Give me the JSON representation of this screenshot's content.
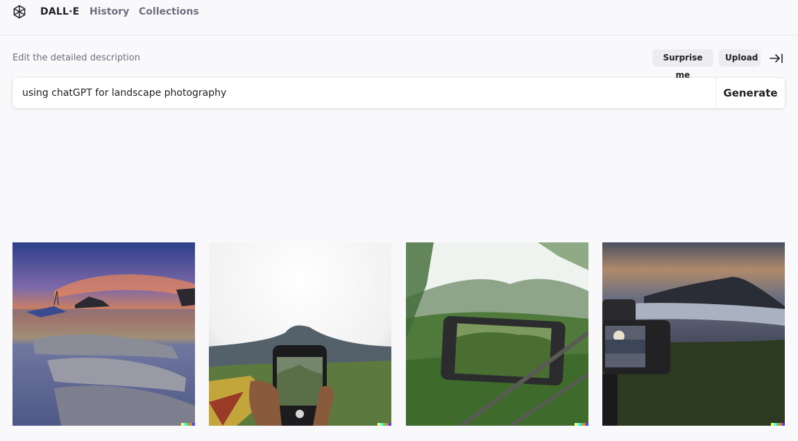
{
  "header": {
    "brand": "DALL·E",
    "nav": [
      {
        "label": "History"
      },
      {
        "label": "Collections"
      }
    ],
    "logo_icon": "openai-logo-icon"
  },
  "editor": {
    "instruction": "Edit the detailed description",
    "surprise_label": "Surprise me",
    "upload_label": "Upload",
    "collapse_icon": "collapse-to-right-icon",
    "prompt_value": "using chatGPT for landscape photography",
    "generate_label": "Generate"
  },
  "results": [
    {
      "kind": "image",
      "subject": "sunset seascape with rocks and boats"
    },
    {
      "kind": "image",
      "subject": "hand holding phone photographing mountain"
    },
    {
      "kind": "image",
      "subject": "phone on railing photographing green valley"
    },
    {
      "kind": "image",
      "subject": "phone on tripod photographing volcano at dusk"
    }
  ],
  "colors": {
    "background": "#f9f9fb",
    "text": "#202123",
    "muted": "#6e6e80",
    "pill": "#ececf1",
    "signature": [
      "#ffff66",
      "#42ffff",
      "#51da4c",
      "#ff6e3c",
      "#3c46ff"
    ]
  }
}
